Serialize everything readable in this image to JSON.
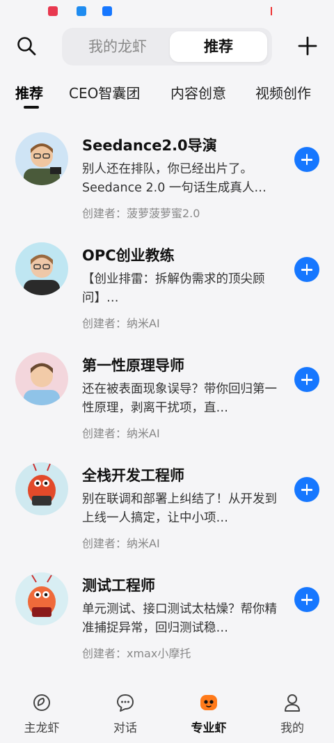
{
  "header": {
    "segment_tabs": [
      "我的龙虾",
      "推荐"
    ],
    "active_segment": "推荐"
  },
  "categories": [
    "推荐",
    "CEO智囊团",
    "内容创意",
    "视频创作"
  ],
  "agents": [
    {
      "title": "Seedance2.0导演",
      "desc": "别人还在排队，你已经出片了。Seedance 2.0 一句话生成真人…",
      "creator": "创建者：菠萝菠萝蜜2.0"
    },
    {
      "title": "OPC创业教练",
      "desc": "【创业排雷：拆解伪需求的顶尖顾问】…",
      "creator": "创建者：纳米AI"
    },
    {
      "title": "第一性原理导师",
      "desc": "还在被表面现象误导？带你回归第一性原理，剥离干扰项，直…",
      "creator": "创建者：纳米AI"
    },
    {
      "title": "全栈开发工程师",
      "desc": "别在联调和部署上纠结了！从开发到上线一人搞定，让中小项…",
      "creator": "创建者：纳米AI"
    },
    {
      "title": "测试工程师",
      "desc": "单元测试、接口测试太枯燥？帮你精准捕捉异常，回归测试稳…",
      "creator": "创建者：xmax小摩托"
    }
  ],
  "tabbar": [
    {
      "label": "主龙虾",
      "icon": "shrimp-outline-icon"
    },
    {
      "label": "对话",
      "icon": "chat-bubble-icon"
    },
    {
      "label": "专业虾",
      "icon": "pro-shrimp-icon"
    },
    {
      "label": "我的",
      "icon": "person-icon"
    }
  ],
  "colors": {
    "accent": "#1677ff",
    "pro_tab": "#ff7a1a"
  }
}
